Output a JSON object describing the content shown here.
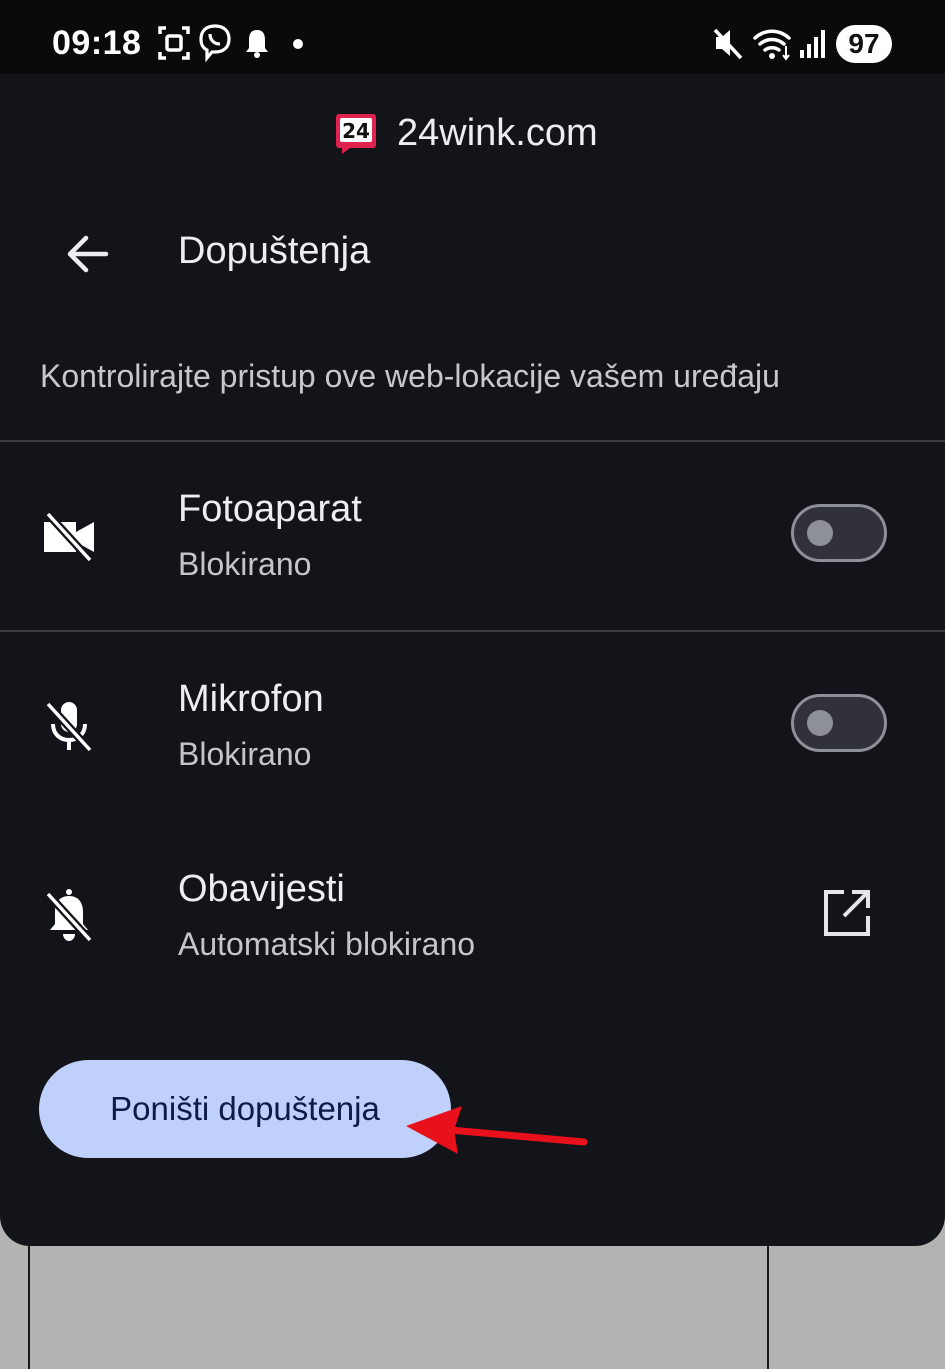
{
  "status_bar": {
    "time": "09:18",
    "battery": "97",
    "icons": [
      "screenshot-icon",
      "viber-icon",
      "notification-bell-icon",
      "dot-icon",
      "mute-icon",
      "wifi-icon",
      "signal-icon"
    ]
  },
  "site": {
    "favicon_text": "24",
    "domain": "24wink.com"
  },
  "header": {
    "title": "Dopuštenja",
    "back_icon": "arrow-back-icon"
  },
  "description": "Kontrolirajte pristup ove web-lokacije vašem uređaju",
  "permissions": [
    {
      "title": "Fotoaparat",
      "status": "Blokirano",
      "icon": "videocam-off-icon",
      "control": "toggle",
      "enabled": false
    },
    {
      "title": "Mikrofon",
      "status": "Blokirano",
      "icon": "mic-off-icon",
      "control": "toggle",
      "enabled": false
    },
    {
      "title": "Obavijesti",
      "status": "Automatski blokirano",
      "icon": "notifications-off-icon",
      "control": "external-link"
    }
  ],
  "reset_button": "Poništi dopuštenja",
  "colors": {
    "sheet_bg": "#131419",
    "status_bar_bg": "#0a0a0a",
    "button_bg": "#bfd0fb",
    "button_text": "#0e1a47",
    "annotation_arrow": "#e8101a",
    "favicon": "#e0224e"
  }
}
